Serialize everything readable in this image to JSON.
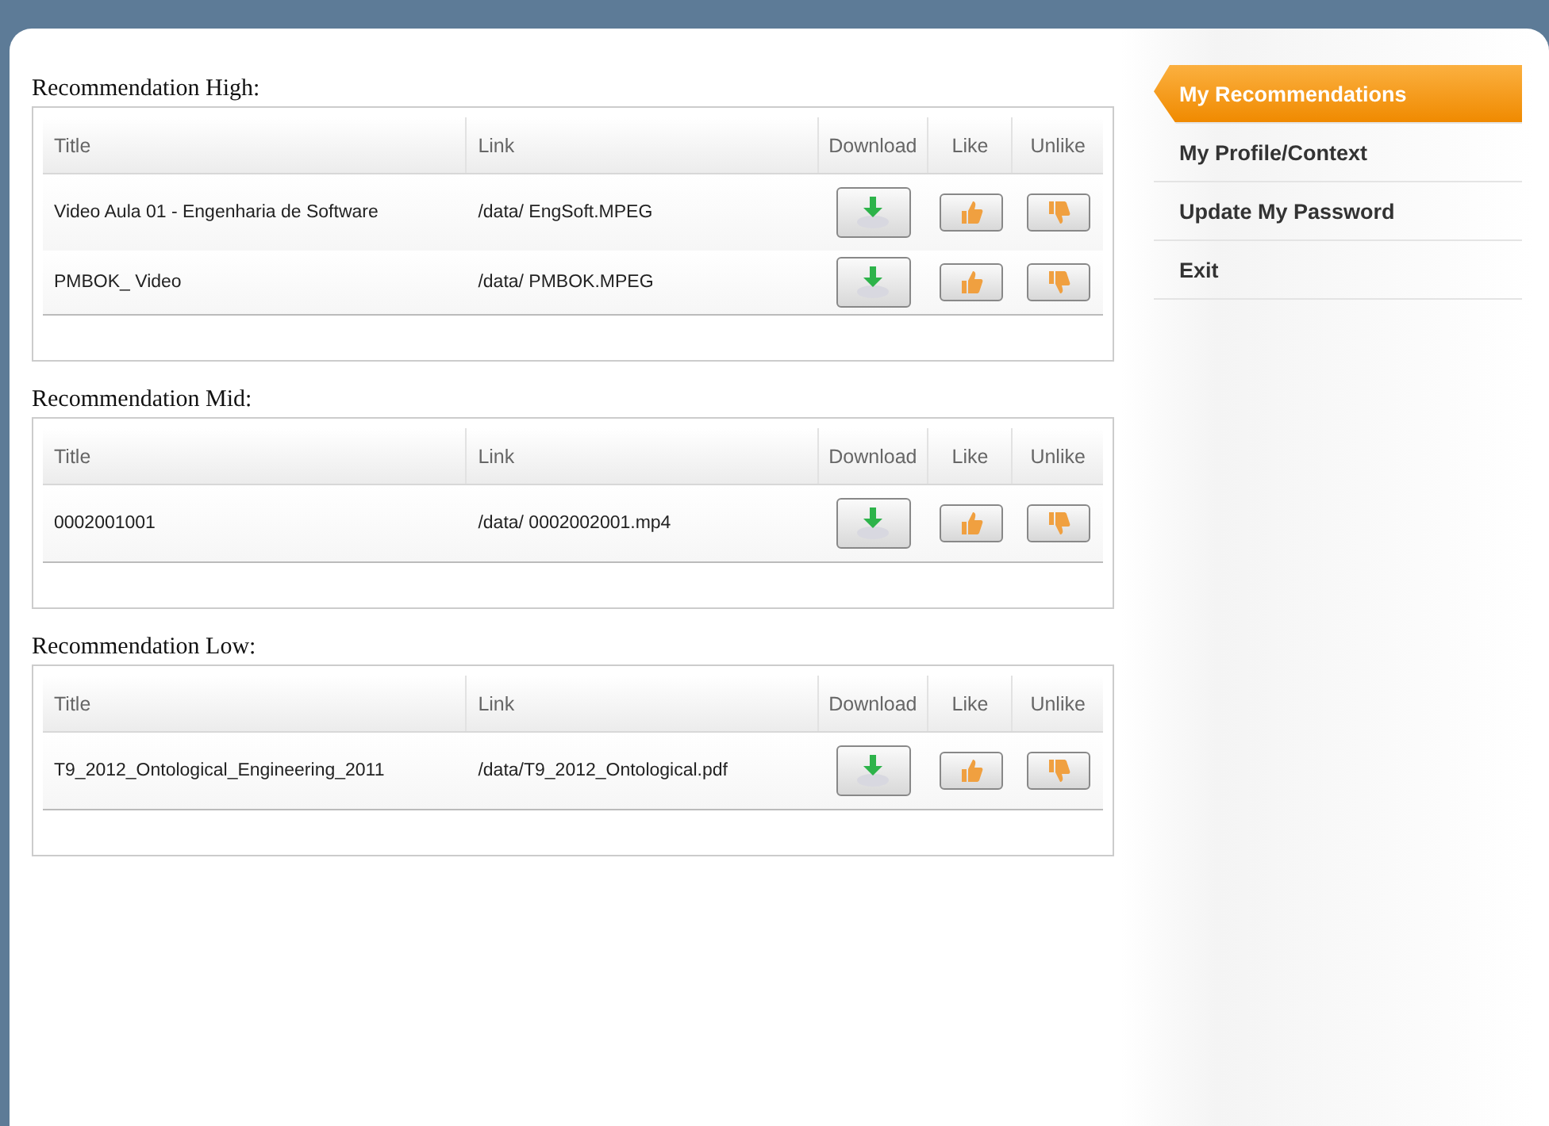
{
  "sections": [
    {
      "heading": "Recommendation High:",
      "columns": [
        "Title",
        "Link",
        "Download",
        "Like",
        "Unlike"
      ],
      "rows": [
        {
          "title": "Video Aula 01 - Engenharia de Software",
          "link": "/data/ EngSoft.MPEG"
        },
        {
          "title": "PMBOK_ Video",
          "link": "/data/ PMBOK.MPEG"
        }
      ]
    },
    {
      "heading": "Recommendation Mid:",
      "columns": [
        "Title",
        "Link",
        "Download",
        "Like",
        "Unlike"
      ],
      "rows": [
        {
          "title": "0002001001",
          "link": "/data/ 0002002001.mp4"
        }
      ]
    },
    {
      "heading": "Recommendation Low:",
      "columns": [
        "Title",
        "Link",
        "Download",
        "Like",
        "Unlike"
      ],
      "rows": [
        {
          "title": "T9_2012_Ontological_Engineering_2011",
          "link": "/data/T9_2012_Ontological.pdf"
        }
      ]
    }
  ],
  "menu": [
    {
      "label": "My Recommendations",
      "selected": true
    },
    {
      "label": "My Profile/Context",
      "selected": false
    },
    {
      "label": "Update My Password",
      "selected": false
    },
    {
      "label": "Exit",
      "selected": false
    }
  ]
}
